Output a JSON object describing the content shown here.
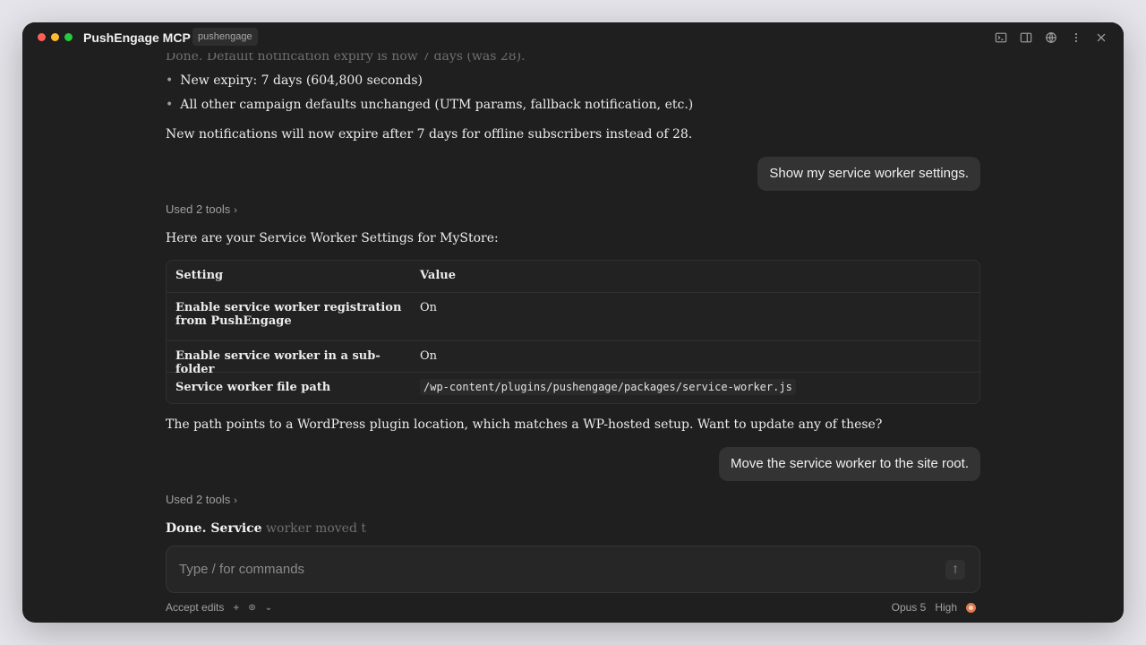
{
  "window": {
    "title": "PushEngage MCP",
    "tag": "pushengage"
  },
  "messages": {
    "faded_top": "Done. Default notification expiry is now 7 days (was 28).",
    "bullets": [
      "New expiry: 7 days (604,800 seconds)",
      "All other campaign defaults unchanged (UTM params, fallback notification, etc.)"
    ],
    "para1": "New notifications will now expire after 7 days for offline subscribers instead of 28.",
    "user1": "Show my service worker settings.",
    "used_tools_1": "Used 2 tools",
    "intro": "Here are your Service Worker Settings for MyStore:",
    "table": {
      "headers": [
        "Setting",
        "Value"
      ],
      "rows": [
        {
          "setting": "Enable service worker registration from PushEngage",
          "value": "On"
        },
        {
          "setting": "Enable service worker in a sub-folder",
          "value": "On"
        },
        {
          "setting": "Service worker file path",
          "value": "/wp-content/plugins/pushengage/packages/service-worker.js"
        }
      ]
    },
    "para2": "The path points to a WordPress plugin location, which matches a WP-hosted setup. Want to update any of these?",
    "user2": "Move the service worker to the site root.",
    "used_tools_2": "Used 2 tools",
    "done_bold": "Done. Service",
    "done_faded": " worker moved t"
  },
  "composer": {
    "placeholder": "Type / for commands"
  },
  "footer": {
    "accept_edits": "Accept edits",
    "plus": "+",
    "model": "Opus 5",
    "effort": "High"
  },
  "colors": {
    "window_bg": "#1f1f1f",
    "accent_orange": "#e07a4f"
  }
}
